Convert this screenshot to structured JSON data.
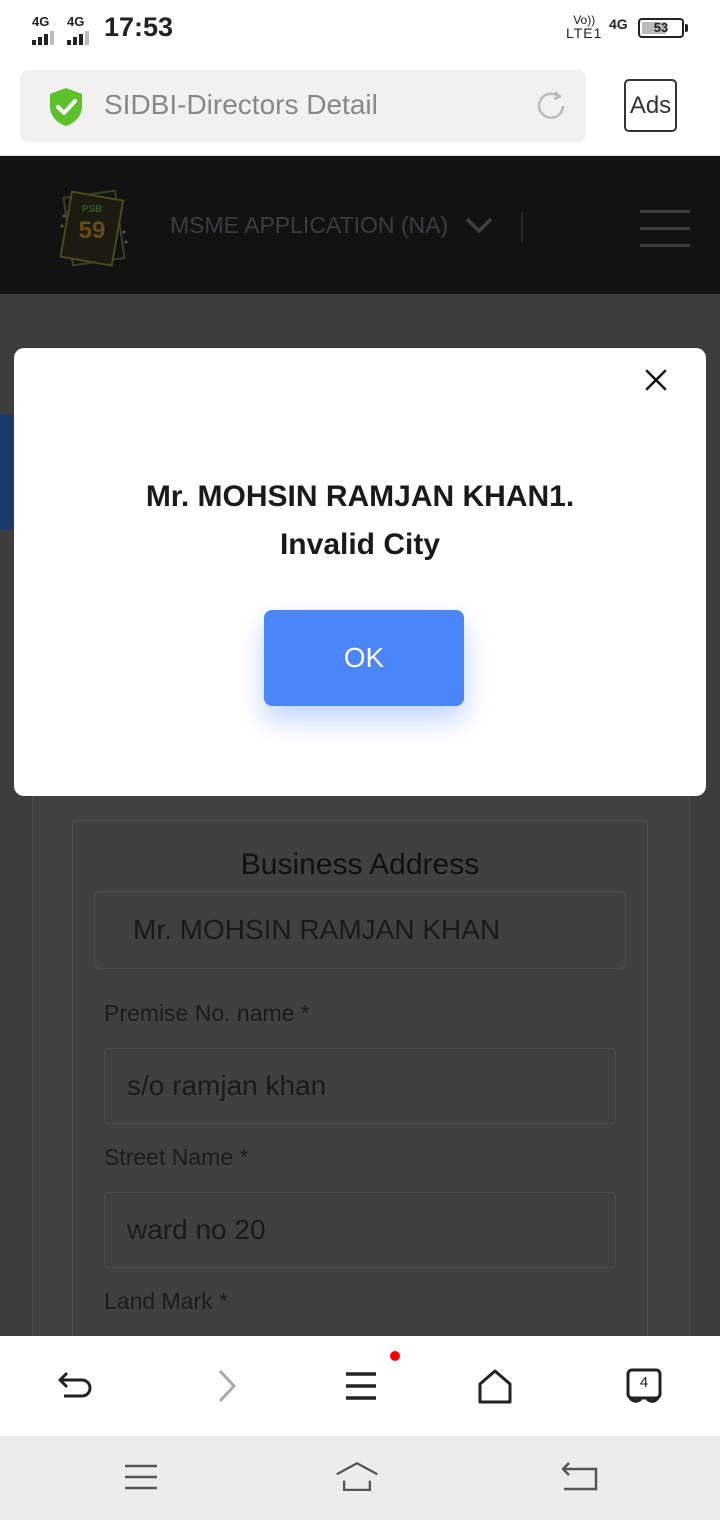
{
  "status_bar": {
    "network_1": "4G",
    "network_2": "4G",
    "time": "17:53",
    "volte_top": "Vo))",
    "volte_bottom": "LTE1",
    "network_right": "4G",
    "battery": "53"
  },
  "browser": {
    "page_title": "SIDBI-Directors Detail",
    "ads_label": "Ads",
    "tab_count": "4"
  },
  "site_header": {
    "logo_top": "PSB",
    "logo_number": "59",
    "app_selector": "MSME APPLICATION (NA)"
  },
  "modal": {
    "line_1": "Mr. MOHSIN RAMJAN KHAN1.",
    "line_2": "Invalid City",
    "ok_label": "OK"
  },
  "form": {
    "section_title": "Business Address",
    "name_value": "Mr. MOHSIN RAMJAN KHAN",
    "premise_label": "Premise No. name *",
    "premise_value": "s/o ramjan khan",
    "street_label": "Street Name *",
    "street_value": "ward no 20",
    "landmark_label": "Land Mark *"
  },
  "colors": {
    "accent": "#4a86f7",
    "shield": "#5cc12a",
    "notification_dot": "#ff0000"
  }
}
